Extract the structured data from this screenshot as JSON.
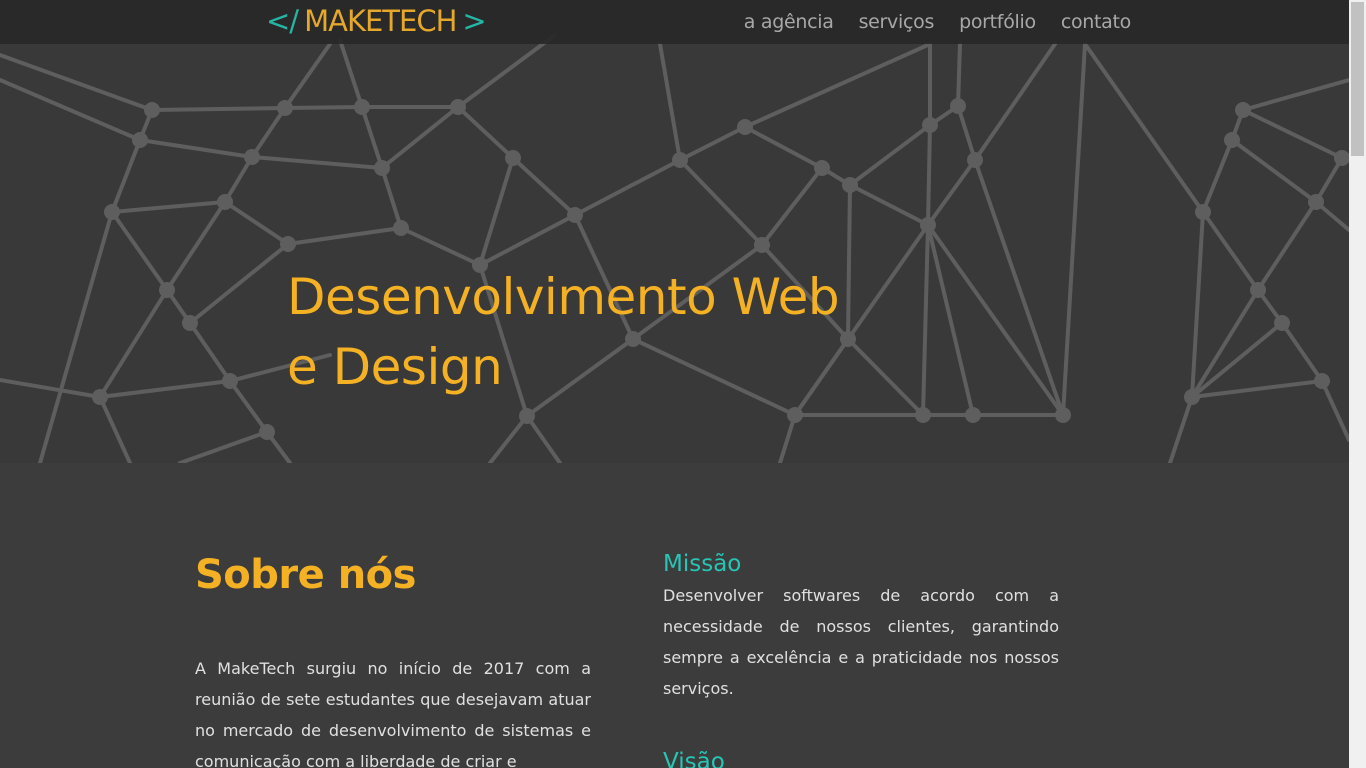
{
  "header": {
    "logo": {
      "open_bracket": "</",
      "brand": "MAKETECH",
      "close_bracket": ">"
    },
    "nav": [
      {
        "label": "a agência"
      },
      {
        "label": "serviços"
      },
      {
        "label": "portfólio"
      },
      {
        "label": "contato"
      }
    ]
  },
  "hero": {
    "title_line1": "Desenvolvimento Web",
    "title_line2": "e Design"
  },
  "about": {
    "heading": "Sobre nós",
    "text": "A MakeTech surgiu no início de 2017 com a reunião de sete estudantes que desejavam atuar no mercado de desenvolvimento de sistemas e comunicação com a liberdade de criar e"
  },
  "mission": {
    "heading": "Missão",
    "text": "Desenvolver softwares de acordo com a necessidade de nossos clientes, garantindo sempre a excelência e a praticidade nos nossos serviços."
  },
  "vision": {
    "heading": "Visão"
  },
  "colors": {
    "accent_yellow": "#f5b124",
    "accent_teal": "#26c6b5",
    "background": "#3c3c3c",
    "network_lines": "#5e5e5e"
  }
}
